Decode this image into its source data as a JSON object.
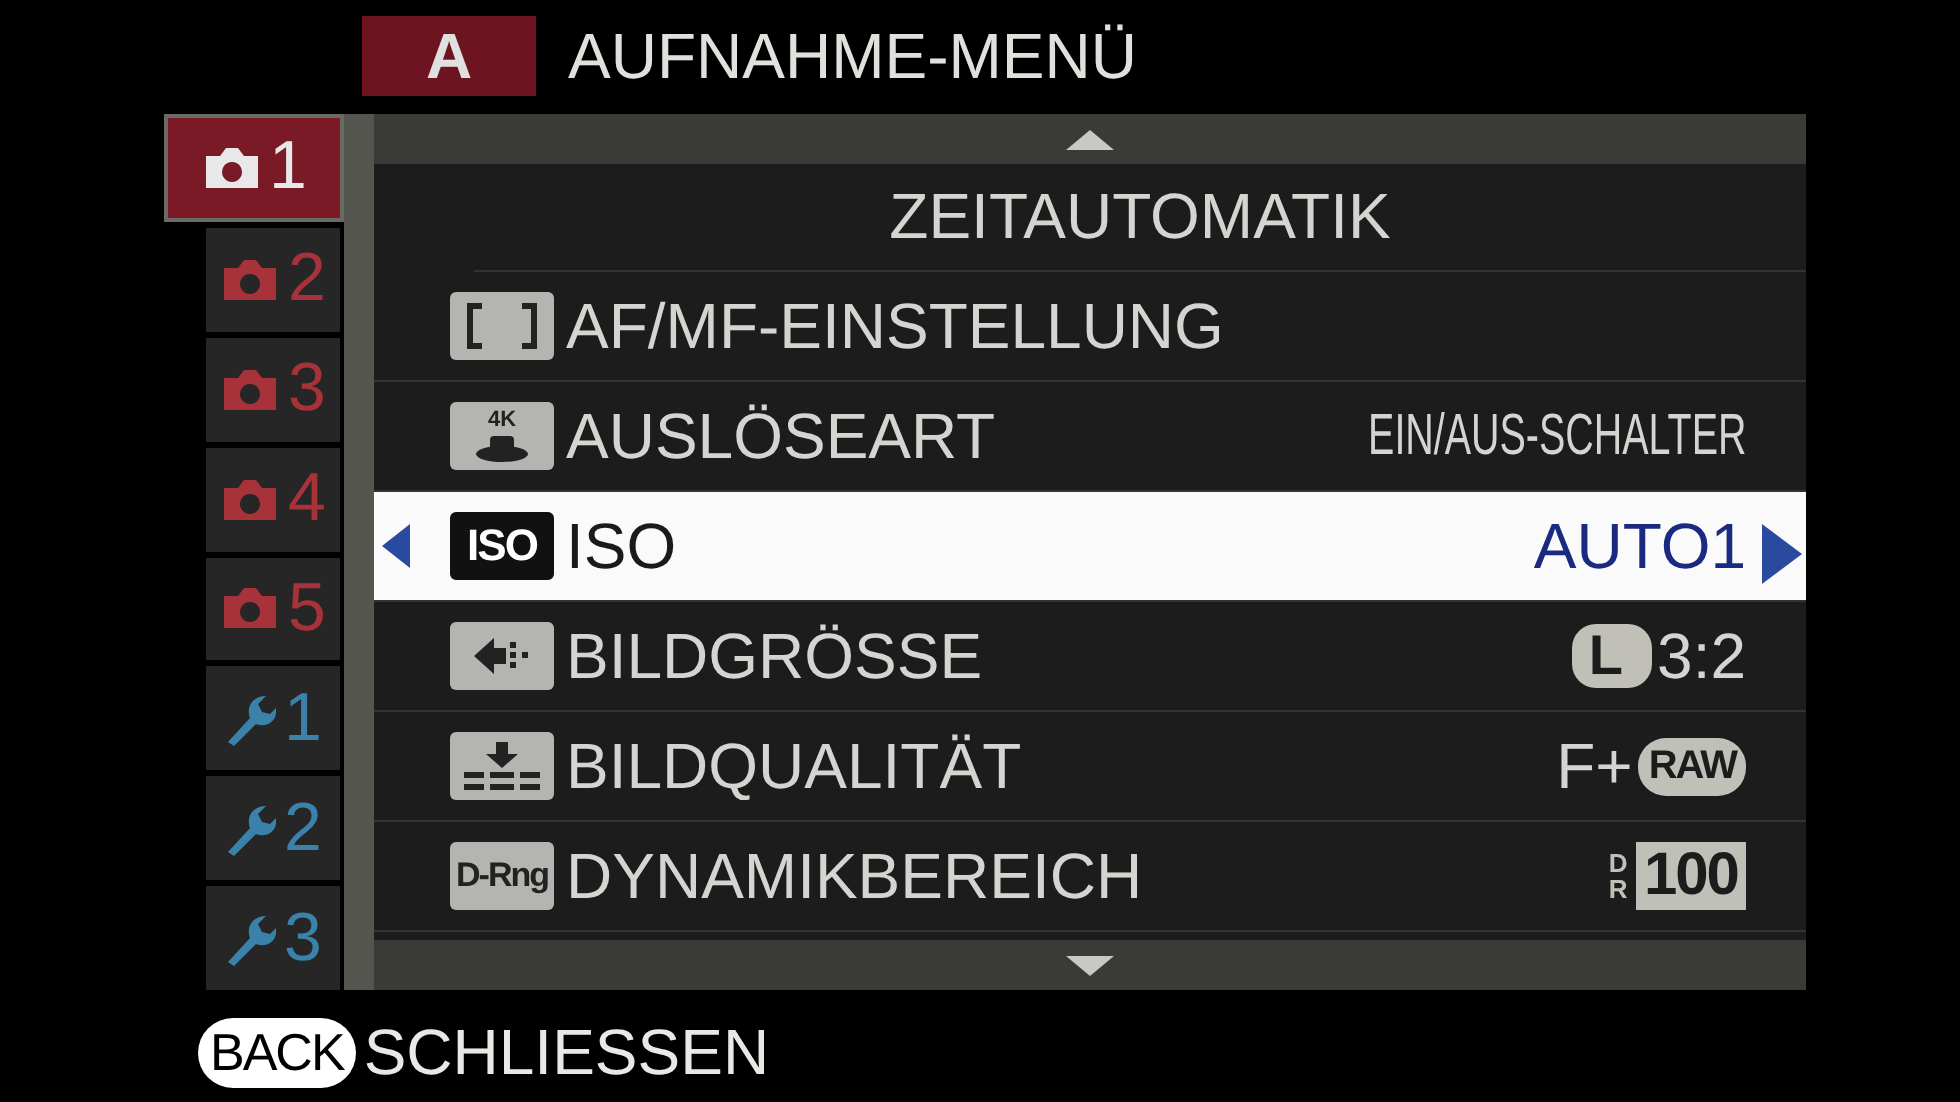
{
  "header": {
    "mode": "A",
    "title": "AUFNAHME-MENÜ"
  },
  "tabs": [
    {
      "kind": "camera",
      "label": "1",
      "selected": true
    },
    {
      "kind": "camera",
      "label": "2",
      "selected": false
    },
    {
      "kind": "camera",
      "label": "3",
      "selected": false
    },
    {
      "kind": "camera",
      "label": "4",
      "selected": false
    },
    {
      "kind": "camera",
      "label": "5",
      "selected": false
    },
    {
      "kind": "wrench",
      "label": "1",
      "selected": false
    },
    {
      "kind": "wrench",
      "label": "2",
      "selected": false
    },
    {
      "kind": "wrench",
      "label": "3",
      "selected": false
    }
  ],
  "menu": {
    "heading": "ZEITAUTOMATIK",
    "items": [
      {
        "kind": "brackets",
        "label": "AF/MF-EINSTELLUNG",
        "selected": false,
        "value": []
      },
      {
        "kind": "drive",
        "icon_text": "4K",
        "label": "AUSLÖSEART",
        "selected": false,
        "value": [
          {
            "kind": "narrow",
            "text": "EIN/AUS-SCHALTER"
          }
        ]
      },
      {
        "kind": "iso",
        "icon_text": "ISO",
        "label": "ISO",
        "selected": true,
        "value": [
          {
            "kind": "text",
            "text": "AUTO1"
          }
        ]
      },
      {
        "kind": "size",
        "label": "BILDGRÖSSE",
        "selected": false,
        "value": [
          {
            "kind": "pill",
            "text": "L"
          },
          {
            "kind": "text",
            "text": "3:2"
          }
        ]
      },
      {
        "kind": "quality",
        "label": "BILDQUALITÄT",
        "selected": false,
        "value": [
          {
            "kind": "text",
            "text": "F+"
          },
          {
            "kind": "oval",
            "text": "RAW"
          }
        ]
      },
      {
        "kind": "label",
        "icon_text": "D-Rng",
        "label": "DYNAMIKBEREICH",
        "selected": false,
        "value": [
          {
            "kind": "stack",
            "text": "DR"
          },
          {
            "kind": "block",
            "text": "100"
          }
        ]
      }
    ]
  },
  "footer": {
    "key": "BACK",
    "action": "SCHLIESSEN"
  }
}
